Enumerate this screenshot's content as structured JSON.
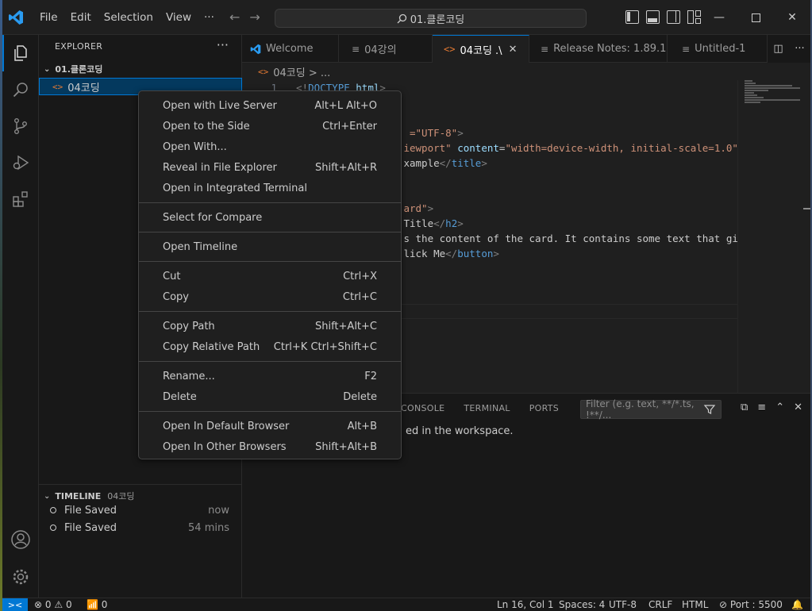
{
  "titlebar": {
    "menu": [
      "File",
      "Edit",
      "Selection",
      "View",
      "···"
    ],
    "command_center": "01.클론코딩"
  },
  "sidebar": {
    "title": "EXPLORER",
    "more": "···",
    "folder": "01.클론코딩",
    "file": "04코딩",
    "timeline": {
      "title": "TIMELINE",
      "subtitle": "04코딩",
      "entries": [
        {
          "label": "File Saved",
          "time": "now"
        },
        {
          "label": "File Saved",
          "time": "54 mins"
        }
      ]
    }
  },
  "tabs": [
    {
      "label": "Welcome",
      "icon": "vscode-logo-icon"
    },
    {
      "label": "04강의",
      "icon": "list-icon"
    },
    {
      "label": "04코딩 .\\",
      "icon": "html-icon",
      "active": true
    },
    {
      "label": "Release Notes: 1.89.1",
      "icon": "list-icon"
    },
    {
      "label": "Untitled-1",
      "icon": "list-icon"
    }
  ],
  "breadcrumb": "04코딩 > ...",
  "editor": {
    "lines": [
      {
        "n": "1",
        "parts": [
          [
            "tag",
            "<!"
          ],
          [
            "kw",
            "DOCTYPE"
          ],
          [
            "txt",
            " "
          ],
          [
            "attr",
            "html"
          ],
          [
            "tag",
            ">"
          ]
        ]
      },
      {
        "n": "",
        "parts": []
      },
      {
        "n": "",
        "parts": []
      },
      {
        "n": "",
        "parts": [
          [
            "txt",
            "                   "
          ],
          [
            "str",
            "=\"UTF-8\""
          ],
          [
            "tag",
            ">"
          ]
        ]
      },
      {
        "n": "",
        "parts": [
          [
            "txt",
            "                  "
          ],
          [
            "str",
            "iewport\""
          ],
          [
            "txt",
            " "
          ],
          [
            "attr",
            "content"
          ],
          [
            "txt",
            "="
          ],
          [
            "str",
            "\"width=device-width, initial-scale=1.0\""
          ]
        ]
      },
      {
        "n": "",
        "parts": [
          [
            "txt",
            "                  "
          ],
          [
            "txt",
            "xample"
          ],
          [
            "tag",
            "</"
          ],
          [
            "kw",
            "title"
          ],
          [
            "tag",
            ">"
          ]
        ]
      },
      {
        "n": "",
        "parts": []
      },
      {
        "n": "",
        "parts": []
      },
      {
        "n": "",
        "parts": [
          [
            "txt",
            "                  "
          ],
          [
            "str",
            "ard\""
          ],
          [
            "tag",
            ">"
          ]
        ]
      },
      {
        "n": "",
        "parts": [
          [
            "txt",
            "                  "
          ],
          [
            "txt",
            "Title"
          ],
          [
            "tag",
            "</"
          ],
          [
            "kw",
            "h2"
          ],
          [
            "tag",
            ">"
          ]
        ]
      },
      {
        "n": "",
        "parts": [
          [
            "txt",
            "                  "
          ],
          [
            "txt",
            "s the content of the card. It contains some text that gi"
          ]
        ]
      },
      {
        "n": "",
        "parts": [
          [
            "txt",
            "                  "
          ],
          [
            "txt",
            "lick Me"
          ],
          [
            "tag",
            "</"
          ],
          [
            "kw",
            "button"
          ],
          [
            "tag",
            ">"
          ]
        ]
      }
    ]
  },
  "panel": {
    "tabs": [
      "CONSOLE",
      "TERMINAL",
      "PORTS"
    ],
    "filter_placeholder": "Filter (e.g. text, **/*.ts, !**/...",
    "message": "ed in the workspace."
  },
  "context_menu": {
    "groups": [
      [
        {
          "label": "Open with Live Server",
          "key": "Alt+L Alt+O"
        },
        {
          "label": "Open to the Side",
          "key": "Ctrl+Enter"
        },
        {
          "label": "Open With...",
          "key": ""
        },
        {
          "label": "Reveal in File Explorer",
          "key": "Shift+Alt+R"
        },
        {
          "label": "Open in Integrated Terminal",
          "key": ""
        }
      ],
      [
        {
          "label": "Select for Compare",
          "key": ""
        }
      ],
      [
        {
          "label": "Open Timeline",
          "key": ""
        }
      ],
      [
        {
          "label": "Cut",
          "key": "Ctrl+X"
        },
        {
          "label": "Copy",
          "key": "Ctrl+C"
        }
      ],
      [
        {
          "label": "Copy Path",
          "key": "Shift+Alt+C"
        },
        {
          "label": "Copy Relative Path",
          "key": "Ctrl+K Ctrl+Shift+C"
        }
      ],
      [
        {
          "label": "Rename...",
          "key": "F2"
        },
        {
          "label": "Delete",
          "key": "Delete"
        }
      ],
      [
        {
          "label": "Open In Default Browser",
          "key": "Alt+B"
        },
        {
          "label": "Open In Other Browsers",
          "key": "Shift+Alt+B"
        }
      ]
    ]
  },
  "statusbar": {
    "remote": "><",
    "errors": "0",
    "warnings": "0",
    "ports": "0",
    "position": "Ln 16, Col 1",
    "spaces": "Spaces: 4",
    "encoding": "UTF-8",
    "eol": "CRLF",
    "language": "HTML",
    "live_server": "Port : 5500"
  },
  "colors": {
    "accent": "#0078d4",
    "html_icon": "#e37933"
  }
}
